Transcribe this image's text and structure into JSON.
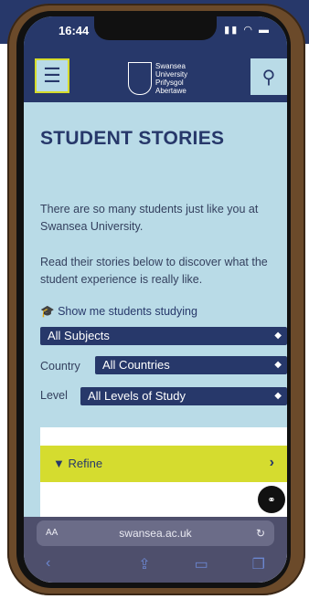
{
  "status": {
    "time": "16:44"
  },
  "header": {
    "logo_lines": [
      "Swansea",
      "University",
      "Prifysgol",
      "Abertawe"
    ]
  },
  "page": {
    "title": "STUDENT STORIES",
    "intro": "There are so many students just like you at Swansea University.",
    "intro2": "Read their stories below to discover what the student experience is really like.",
    "show_label": "Show me students studying"
  },
  "filters": {
    "subject": "All Subjects",
    "country_label": "Country",
    "country": "All Countries",
    "level_label": "Level",
    "level": "All Levels of Study"
  },
  "refine": {
    "label": "Refine"
  },
  "browser": {
    "aa": "AA",
    "url": "swansea.ac.uk"
  },
  "icons": {
    "menu": "hamburger-icon",
    "search": "search-icon",
    "chevron": "chevron-updown-icon",
    "refine": "filter-icon",
    "link": "link-icon",
    "reload": "reload-icon",
    "back": "back-icon",
    "forward": "forward-icon",
    "share": "share-icon",
    "bookmarks": "bookmarks-icon",
    "tabs": "tabs-icon"
  },
  "colors": {
    "navy": "#27386a",
    "light_blue": "#b9dbe7",
    "lime": "#d5dc2f"
  }
}
